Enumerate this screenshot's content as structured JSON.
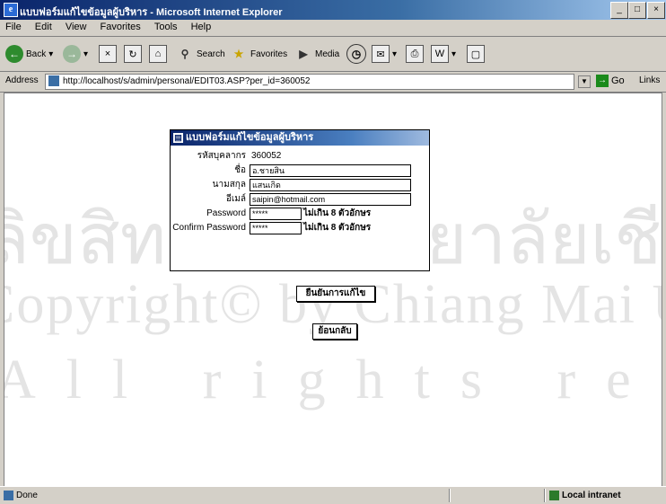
{
  "window": {
    "title": "แบบฟอร์มแก้ไขข้อมูลผู้บริหาร - Microsoft Internet Explorer",
    "controls": [
      "_",
      "□",
      "×"
    ]
  },
  "menu": [
    "File",
    "Edit",
    "View",
    "Favorites",
    "Tools",
    "Help"
  ],
  "toolbar": {
    "back": "Back",
    "search": "Search",
    "favorites": "Favorites",
    "media": "Media"
  },
  "address": {
    "label": "Address",
    "url": "http://localhost/s/admin/personal/EDIT03.ASP?per_id=360052",
    "go": "Go",
    "links": "Links"
  },
  "form": {
    "title": "แบบฟอร์มแก้ไขข้อมูลผู้บริหาร",
    "fields": [
      {
        "label": "รหัสบุคลากร",
        "value": "360052"
      },
      {
        "label": "ชื่อ",
        "value": "อ.ชายสิน"
      },
      {
        "label": "นามสกุล",
        "value": "แสนเกิด"
      },
      {
        "label": "อีเมล์",
        "value": "saipin@hotmail.com"
      },
      {
        "label": "Password",
        "value": "*****",
        "hint": "ไม่เกิน 8 ตัวอักษร"
      },
      {
        "label": "Confirm Password",
        "value": "*****",
        "hint": "ไม่เกิน 8 ตัวอักษร"
      }
    ],
    "save_button": "ยืนยันการแก้ไข",
    "back_button": "ย้อนกลับ"
  },
  "watermark": {
    "line1": "ลิขสิทธิ์มหาวิทยาลัยเชียงใหม่",
    "line2": "Copyright© by Chiang Mai University",
    "line3": "All rights reserved"
  },
  "status": {
    "text": "Done",
    "zone": "Local intranet"
  },
  "colors": {
    "title_bar": "#0a246a",
    "chrome": "#d4d0c8",
    "go_green": "#1b8a1b"
  }
}
